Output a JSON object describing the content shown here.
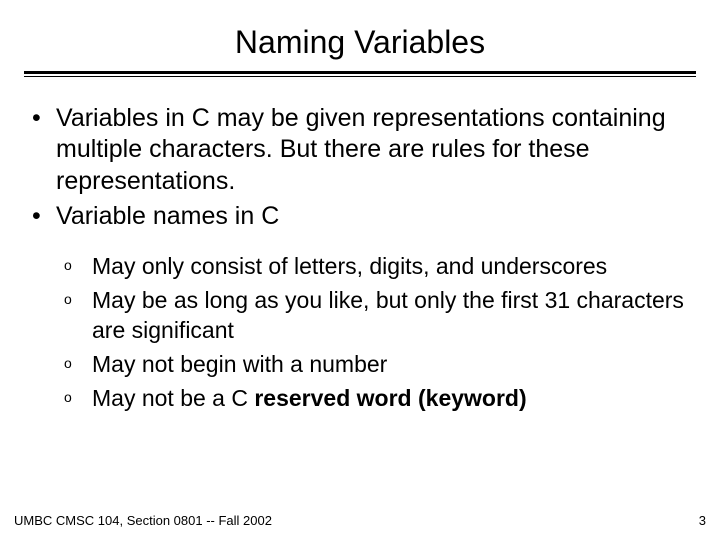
{
  "slide": {
    "title": "Naming Variables",
    "bullets": [
      "Variables in C may be given representations containing multiple characters.  But there are rules for these representations.",
      "Variable names in C"
    ],
    "sub_bullets": [
      {
        "text": "May only consist of letters, digits, and underscores"
      },
      {
        "text_prefix": "May be as long as you like, but only the first 31 characters are significant"
      },
      {
        "text": "May not begin with a number"
      },
      {
        "text_prefix": "May not be a C ",
        "bold_suffix": "reserved word (keyword)"
      }
    ],
    "footer_left": "UMBC CMSC 104, Section 0801 -- Fall 2002",
    "footer_right": "3"
  }
}
